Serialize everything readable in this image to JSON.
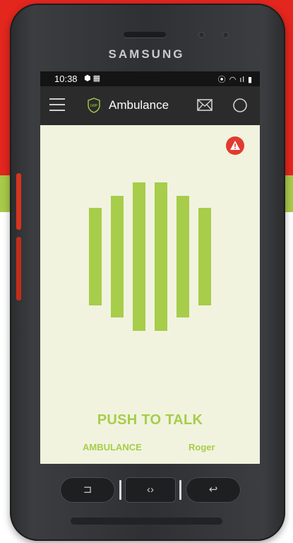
{
  "device": {
    "brand": "SAMSUNG",
    "colors": {
      "background_top": "#e3261e",
      "background_band": "#a8c94a",
      "accent": "#a7cd4a",
      "alert": "#e23a2e"
    }
  },
  "status_bar": {
    "time": "10:38",
    "left_icons": "⬢ ▦",
    "right_icons": "⦿ ◠ ıl ▮"
  },
  "app_bar": {
    "menu_icon": "hamburger-icon",
    "logo_text": "LWP",
    "title": "Ambulance",
    "mail_icon": "mail-icon",
    "power_icon": "power-icon"
  },
  "main": {
    "alert_icon": "warning-icon",
    "voice_icon": "audio-bars-icon",
    "push_to_talk_label": "PUSH TO TALK",
    "channel_label": "AMBULANCE",
    "status_label": "Roger"
  },
  "nav_keys": [
    {
      "name": "recent-apps-icon",
      "glyph": "⊐"
    },
    {
      "name": "home-icon",
      "glyph": "‹›"
    },
    {
      "name": "back-icon",
      "glyph": "↩"
    }
  ]
}
